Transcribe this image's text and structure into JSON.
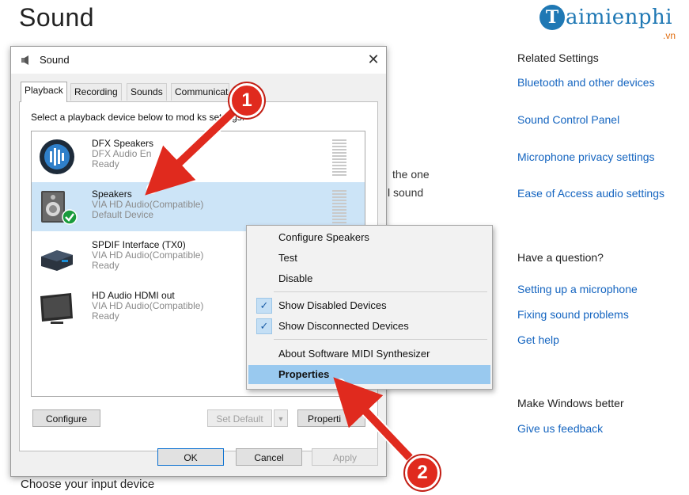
{
  "page": {
    "title": "Sound",
    "partial_text_line1": "the one",
    "partial_text_line2": "l sound",
    "bottom_text": "Choose your input device"
  },
  "logo": {
    "letter": "T",
    "text": "aimienphi",
    "suffix": ".vn"
  },
  "related": {
    "heading": "Related Settings",
    "links": [
      "Bluetooth and other devices",
      "Sound Control Panel",
      "Microphone privacy settings",
      "Ease of Access audio settings"
    ],
    "question_heading": "Have a question?",
    "help_links": [
      "Setting up a microphone",
      "Fixing sound problems",
      "Get help"
    ],
    "better_heading": "Make Windows better",
    "feedback_link": "Give us feedback"
  },
  "dialog": {
    "title": "Sound",
    "tabs": [
      "Playback",
      "Recording",
      "Sounds",
      "Communicati"
    ],
    "instruction": "Select a playback device below to mod   ks settings:",
    "devices": [
      {
        "name": "DFX Speakers",
        "line2": "DFX Audio En",
        "line3": "Ready"
      },
      {
        "name": "Speakers",
        "line2": "VIA HD Audio(Compatible)",
        "line3": "Default Device"
      },
      {
        "name": "SPDIF Interface (TX0)",
        "line2": "VIA HD Audio(Compatible)",
        "line3": "Ready"
      },
      {
        "name": "HD Audio HDMI out",
        "line2": "VIA HD Audio(Compatible)",
        "line3": "Ready"
      }
    ],
    "buttons": {
      "configure": "Configure",
      "set_default": "Set Default",
      "properties": "Properti",
      "ok": "OK",
      "cancel": "Cancel",
      "apply": "Apply"
    }
  },
  "context_menu": {
    "items": [
      "Configure Speakers",
      "Test",
      "Disable",
      "Show Disabled Devices",
      "Show Disconnected Devices",
      "About Software MIDI Synthesizer",
      "Properties"
    ],
    "checked": [
      false,
      false,
      false,
      true,
      true,
      false,
      false
    ],
    "check_glyph": "✓"
  },
  "annotations": {
    "step1": "1",
    "step2": "2"
  },
  "colors": {
    "accent_link": "#1565c0",
    "selection": "#cce4f7",
    "menu_highlight": "#99c9ef",
    "callout_red": "#e02a1e"
  }
}
